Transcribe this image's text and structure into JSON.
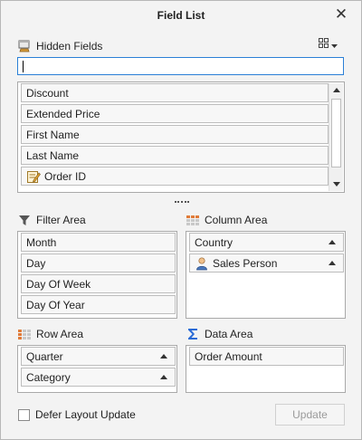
{
  "window": {
    "title": "Field List"
  },
  "hidden_fields": {
    "label": "Hidden Fields",
    "search_value": "",
    "items": [
      {
        "label": "Discount",
        "icon": null
      },
      {
        "label": "Extended Price",
        "icon": null
      },
      {
        "label": "First Name",
        "icon": null
      },
      {
        "label": "Last Name",
        "icon": null
      },
      {
        "label": "Order ID",
        "icon": "edit-note-icon"
      }
    ]
  },
  "filter_area": {
    "label": "Filter Area",
    "items": [
      "Month",
      "Day",
      "Day Of Week",
      "Day Of Year"
    ]
  },
  "column_area": {
    "label": "Column Area",
    "items": [
      {
        "label": "Country",
        "icon": null
      },
      {
        "label": "Sales Person",
        "icon": "person-icon"
      }
    ]
  },
  "row_area": {
    "label": "Row Area",
    "items": [
      "Quarter",
      "Category"
    ]
  },
  "data_area": {
    "label": "Data Area",
    "items": [
      "Order Amount"
    ]
  },
  "footer": {
    "defer_label": "Defer Layout Update",
    "defer_checked": false,
    "update_label": "Update"
  },
  "colors": {
    "accent": "#2a7fd6",
    "grid_icon": "#e07b39",
    "sigma": "#2a6bd6"
  }
}
